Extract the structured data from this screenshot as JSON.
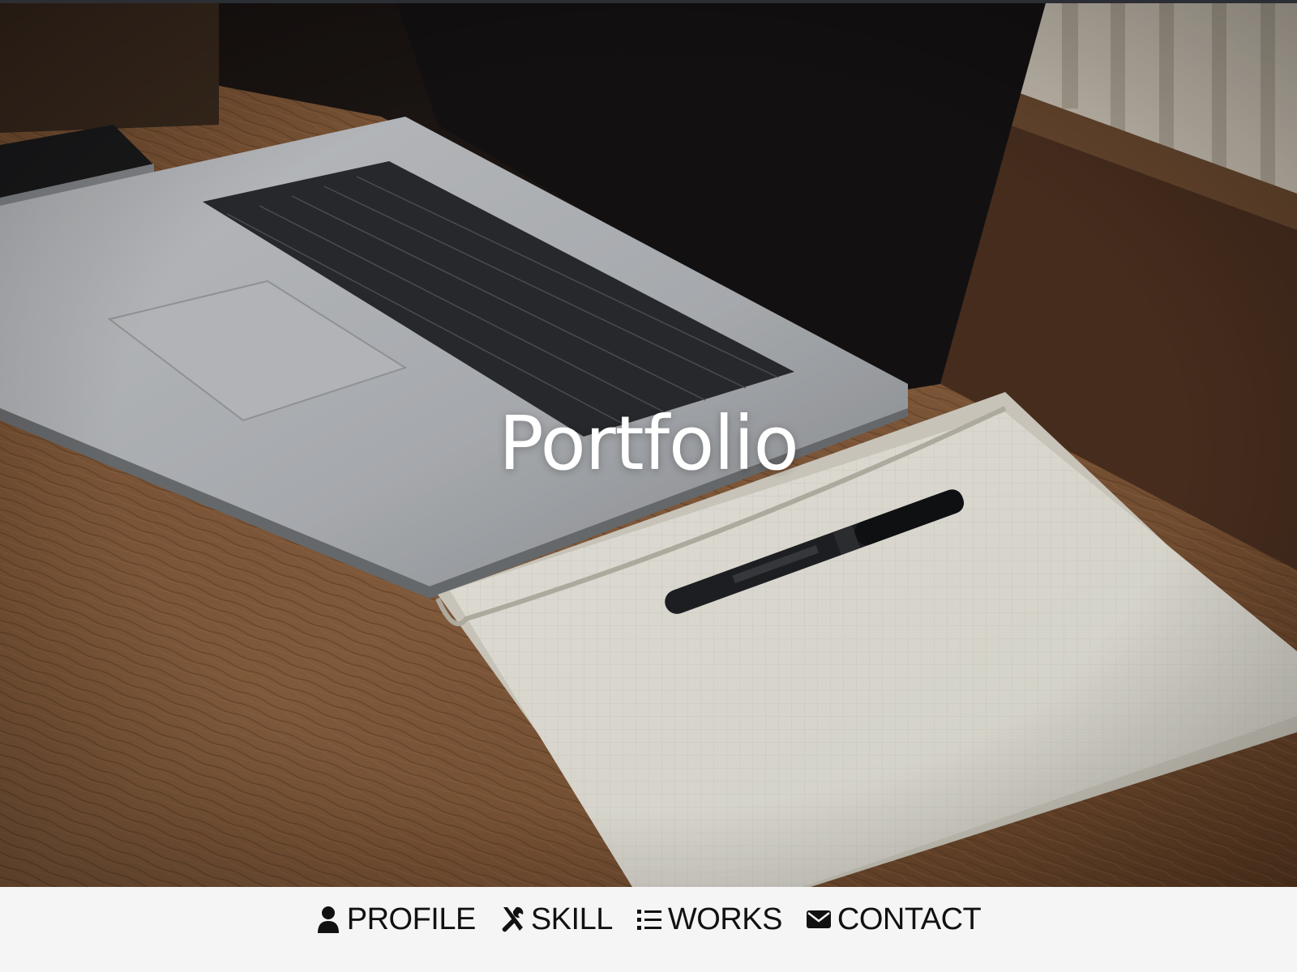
{
  "hero": {
    "title": "Portfolio",
    "image_description_icon": "desk-photo"
  },
  "nav": {
    "items": [
      {
        "label": "PROFILE",
        "icon": "user-icon"
      },
      {
        "label": "SKILL",
        "icon": "tools-icon"
      },
      {
        "label": "WORKS",
        "icon": "list-icon"
      },
      {
        "label": "CONTACT",
        "icon": "envelope-icon"
      }
    ]
  },
  "colors": {
    "navbar_bg": "#f5f5f5",
    "nav_text": "#111111",
    "hero_title": "#ffffff"
  }
}
